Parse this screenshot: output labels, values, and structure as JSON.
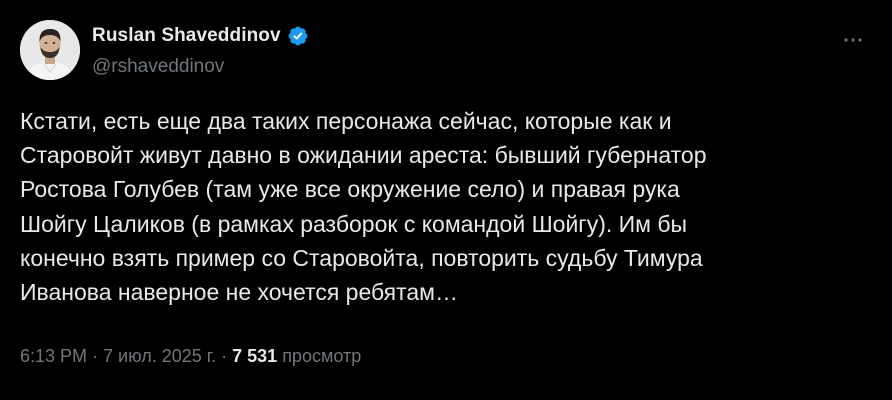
{
  "author": {
    "display_name": "Ruslan Shaveddinov",
    "handle": "@rshaveddinov",
    "verified": true,
    "verified_color": "#1d9bf0"
  },
  "tweet": {
    "text": "Кстати, есть еще два таких персонажа сейчас, которые как и\nСтаровойт живут давно в ожидании ареста: бывший губернатор\nРостова Голубев (там уже все окружение село) и правая рука\nШойгу Цаликов (в рамках разборок с командой Шойгу). Им бы\nконечно взять пример со Старовойта, повторить судьбу Тимура\nИванова наверное не хочется ребятам…"
  },
  "meta": {
    "time": "6:13 PM",
    "separator": "·",
    "date": "7 июл. 2025 г.",
    "views_count": "7 531",
    "views_label": "просмотр"
  },
  "icons": {
    "more": "more-horizontal-icon",
    "verified": "verified-badge-icon"
  },
  "colors": {
    "background": "#000000",
    "primary_text": "#e7e9ea",
    "secondary_text": "#71767b",
    "accent": "#1d9bf0"
  }
}
